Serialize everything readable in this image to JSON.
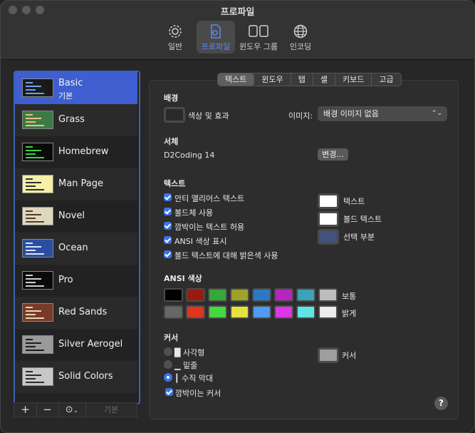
{
  "window": {
    "title": "프로파일"
  },
  "toolbar": [
    {
      "label": "일반",
      "icon": "gear-icon"
    },
    {
      "label": "프로파일",
      "icon": "profile-document-icon",
      "active": true
    },
    {
      "label": "윈도우 그룹",
      "icon": "window-group-icon"
    },
    {
      "label": "인코딩",
      "icon": "globe-icon"
    }
  ],
  "profiles": [
    {
      "name": "Basic",
      "sub": "기본",
      "bg": "#1a1a1a",
      "fg": "#6aa0ff"
    },
    {
      "name": "Grass",
      "bg": "#3a7a45",
      "fg": "#f0c080"
    },
    {
      "name": "Homebrew",
      "bg": "#0a0a0a",
      "fg": "#3cd63c"
    },
    {
      "name": "Man Page",
      "bg": "#f5efa8",
      "fg": "#333333"
    },
    {
      "name": "Novel",
      "bg": "#ddd8c0",
      "fg": "#5a3c2a"
    },
    {
      "name": "Ocean",
      "bg": "#2a4fa0",
      "fg": "#e0e0ff"
    },
    {
      "name": "Pro",
      "bg": "#0a0a0a",
      "fg": "#d0d0d0"
    },
    {
      "name": "Red Sands",
      "bg": "#7a3a2a",
      "fg": "#e8d8b0"
    },
    {
      "name": "Silver Aerogel",
      "bg": "#9a9a9a",
      "fg": "#1a1a1a"
    },
    {
      "name": "Solid Colors",
      "bg": "#c8c8c8",
      "fg": "#2a2a2a"
    }
  ],
  "bottom_bar": {
    "add": "+",
    "remove": "−",
    "more": "⊙",
    "default": "기본"
  },
  "tabs": [
    "텍스트",
    "윈도우",
    "탭",
    "셸",
    "키보드",
    "고급"
  ],
  "background": {
    "header": "배경",
    "color_label": "색상 및 효과",
    "image_label": "이미지:",
    "image_value": "배경 이미지 없음"
  },
  "font": {
    "header": "서체",
    "value": "D2Coding 14",
    "change": "변경..."
  },
  "text": {
    "header": "텍스트",
    "checks": [
      "안티 앨리어스 텍스트",
      "볼드체 사용",
      "깜박이는 텍스트 허용",
      "ANSI 색상 표시",
      "볼드 텍스트에 대해 밝은색 사용"
    ],
    "colors": [
      {
        "label": "텍스트",
        "color": "#ffffff"
      },
      {
        "label": "볼드 텍스트",
        "color": "#ffffff"
      },
      {
        "label": "선택 부분",
        "color": "#41537a"
      }
    ]
  },
  "ansi": {
    "header": "ANSI 색상",
    "normal_label": "보통",
    "bright_label": "밝게",
    "normal": [
      "#000000",
      "#9a1a10",
      "#33a93a",
      "#9ea325",
      "#2d78c5",
      "#b326c0",
      "#3aa3b5",
      "#bdbdbd"
    ],
    "bright": [
      "#676767",
      "#e0341f",
      "#44d93e",
      "#e6e23c",
      "#4e9bf2",
      "#df36e5",
      "#5fe5e5",
      "#ececec"
    ]
  },
  "cursor": {
    "header": "커서",
    "options": [
      "█ 사각형",
      "▁ 밑줄",
      "┃ 수직 막대"
    ],
    "selected": 2,
    "blink": "깜박이는 커서",
    "color_label": "커서",
    "color": "#9e9e9e"
  },
  "help": "?"
}
